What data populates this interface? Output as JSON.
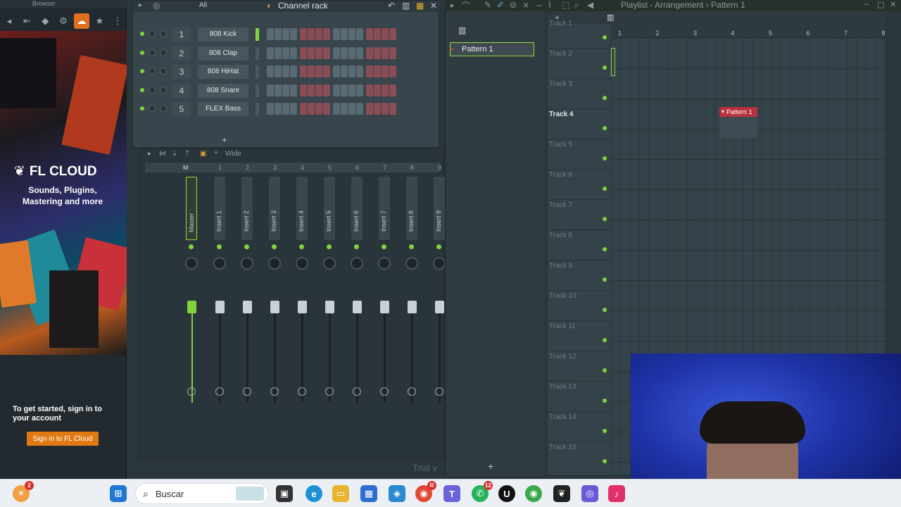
{
  "browser": {
    "title": "Browser",
    "cloud_logo": "FL CLOUD",
    "cloud_tagline": "Sounds, Plugins, Mastering and more",
    "signin_text": "To get started, sign in to your account",
    "signin_button": "Sign in to FL Cloud"
  },
  "channel_rack": {
    "title": "Channel rack",
    "filter": "All",
    "channels": [
      {
        "num": "1",
        "name": "808 Kick"
      },
      {
        "num": "2",
        "name": "808 Clap"
      },
      {
        "num": "3",
        "name": "808 HiHat"
      },
      {
        "num": "4",
        "name": "808 Snare"
      },
      {
        "num": "5",
        "name": "FLEX Bass"
      }
    ]
  },
  "mixer": {
    "mode": "Wide",
    "master_label": "Master",
    "master_header": "M",
    "insert_labels": [
      "Insert 1",
      "Insert 2",
      "Insert 3",
      "Insert 4",
      "Insert 5",
      "Insert 6",
      "Insert 7",
      "Insert 8",
      "Insert 9"
    ],
    "insert_numbers": [
      "1",
      "2",
      "3",
      "4",
      "5",
      "6",
      "7",
      "8",
      "9"
    ],
    "watermark": "Trial v"
  },
  "picker": {
    "pattern": "Pattern 1"
  },
  "playlist": {
    "title": "Playlist - Arrangement › Pattern 1",
    "ruler": [
      "1",
      "2",
      "3",
      "4",
      "5",
      "6",
      "7",
      "8"
    ],
    "tracks": [
      "Track 1",
      "Track 2",
      "Track 3",
      "Track 4",
      "Track 5",
      "Track 6",
      "Track 7",
      "Track 8",
      "Track 9",
      "Track 10",
      "Track 11",
      "Track 12",
      "Track 13",
      "Track 14",
      "Track 15"
    ],
    "active_track": "Track 4",
    "clip_label": "Pattern 1"
  },
  "taskbar": {
    "search_placeholder": "Buscar",
    "badge_left": "2",
    "badge_chrome": "R",
    "badge_teams": "12"
  },
  "colors": {
    "accent_green": "#7fd43b",
    "clip_red": "#b8323d",
    "cloud_orange": "#e27a14"
  }
}
